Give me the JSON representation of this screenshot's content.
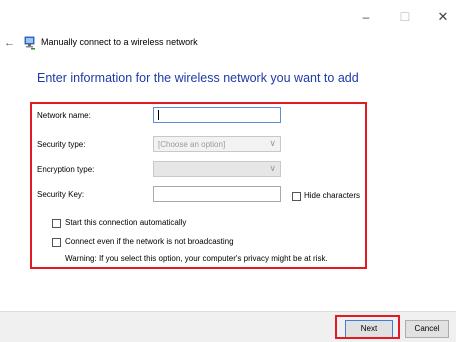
{
  "window": {
    "minimize_glyph": "–",
    "maximize_glyph": "☐",
    "close_glyph": "✕"
  },
  "nav": {
    "back_glyph": "←",
    "icon": "wireless-network-icon",
    "title": "Manually connect to a wireless network"
  },
  "heading": "Enter information for the wireless network you want to add",
  "form": {
    "network_name_label": "Network name:",
    "network_name_value": "",
    "security_type_label": "Security type:",
    "security_type_value": "[Choose an option]",
    "encryption_type_label": "Encryption type:",
    "encryption_type_value": "",
    "security_key_label": "Security Key:",
    "security_key_value": "",
    "hide_characters_label": "Hide characters",
    "start_automatically_label": "Start this connection automatically",
    "connect_not_broadcasting_label": "Connect even if the network is not broadcasting",
    "warning_text": "Warning: If you select this option, your computer's privacy might be at risk.",
    "dropdown_glyph": "∨"
  },
  "footer": {
    "next_label": "Next",
    "cancel_label": "Cancel"
  },
  "colors": {
    "highlight": "#e01b24",
    "heading": "#1e3aa8"
  }
}
